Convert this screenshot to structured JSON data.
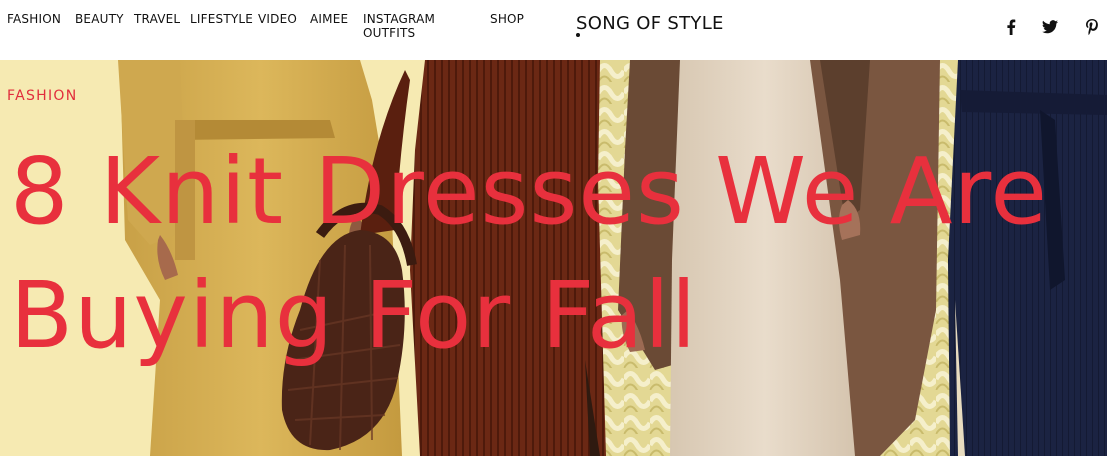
{
  "nav": {
    "items": [
      {
        "label": "FASHION"
      },
      {
        "label": "BEAUTY"
      },
      {
        "label": "TRAVEL"
      },
      {
        "label": "LIFESTYLE"
      },
      {
        "label": "VIDEO"
      },
      {
        "label": "AIMEE"
      },
      {
        "label": "INSTAGRAM"
      },
      {
        "label": "OUTFITS"
      },
      {
        "label": "SHOP"
      }
    ]
  },
  "brand": {
    "name": "SONG OF STYLE"
  },
  "social": {
    "icons": [
      "facebook-icon",
      "twitter-icon",
      "pinterest-icon"
    ]
  },
  "article": {
    "category": "FASHION",
    "headline_line1": "8 Knit Dresses We Are",
    "headline_line2": "Buying For Fall"
  },
  "colors": {
    "accent_red": "#e8303d",
    "hero_background": "#f6eab2",
    "text_dark": "#111111"
  }
}
